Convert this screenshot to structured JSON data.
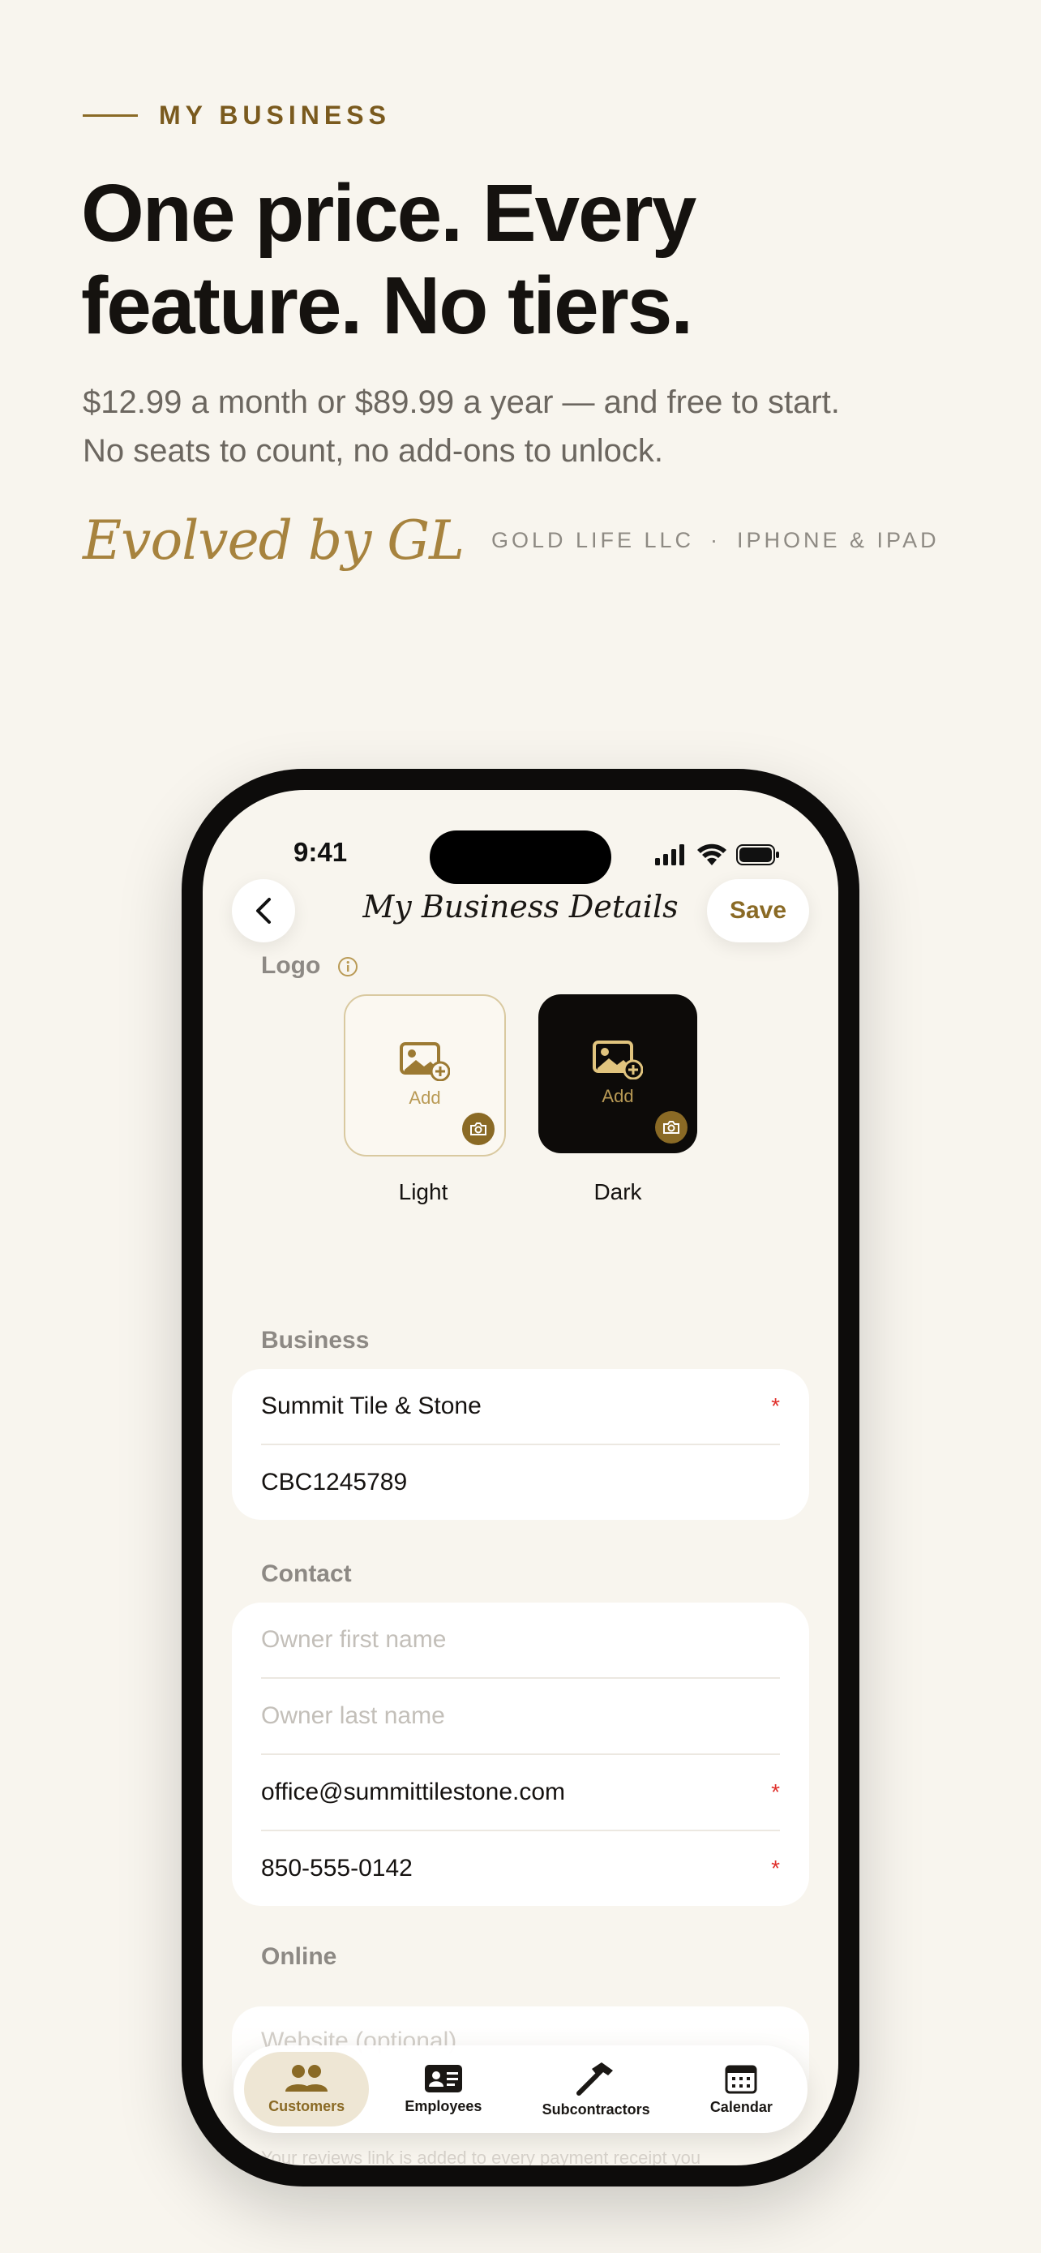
{
  "hero": {
    "eyebrow": "MY BUSINESS",
    "headline_line1": "One price. Every",
    "headline_line2": "feature. No tiers.",
    "sub_line1": "$12.99 a month or $89.99 a year — and free to start.",
    "sub_line2": "No seats to count, no add-ons to unlock.",
    "signature": "Evolved by GL",
    "company": "GOLD LIFE LLC",
    "separator": "·",
    "platforms": "IPHONE & IPAD"
  },
  "status_bar": {
    "time": "9:41"
  },
  "nav": {
    "title": "My Business Details",
    "save_label": "Save"
  },
  "logo": {
    "section_label": "Logo",
    "add_label": "Add",
    "light_caption": "Light",
    "dark_caption": "Dark"
  },
  "business": {
    "section_label": "Business",
    "name": "Summit Tile & Stone",
    "license": "CBC1245789",
    "required_mark": "*"
  },
  "contact": {
    "section_label": "Contact",
    "first_name_placeholder": "Owner first name",
    "last_name_placeholder": "Owner last name",
    "email": "office@summittilestone.com",
    "phone": "850-555-0142",
    "required_mark": "*"
  },
  "online": {
    "section_label": "Online",
    "website_placeholder": "Website (optional)",
    "footnote": "Your reviews link is added to every payment receipt you"
  },
  "tabs": [
    {
      "label": "Customers",
      "icon": "customers-icon"
    },
    {
      "label": "Employees",
      "icon": "id-card-icon"
    },
    {
      "label": "Subcontractors",
      "icon": "hammer-icon"
    },
    {
      "label": "Calendar",
      "icon": "calendar-icon"
    }
  ],
  "colors": {
    "background": "#f8f5ee",
    "accent_gold": "#8a6a25",
    "required_red": "#e0302b"
  }
}
